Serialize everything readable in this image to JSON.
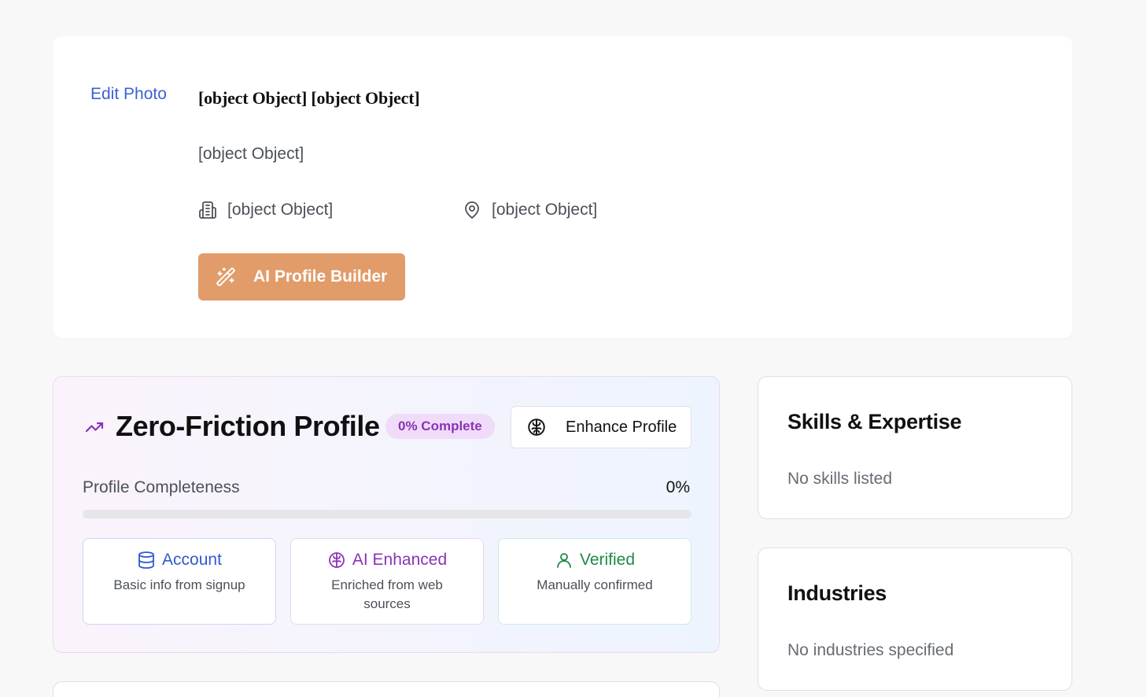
{
  "profile": {
    "edit_photo": "Edit Photo",
    "name": "[object Object] [object Object]",
    "headline": "[object Object]",
    "company": "[object Object]",
    "location": "[object Object]",
    "ai_builder_label": "AI Profile Builder",
    "icons": {
      "company": "building-icon",
      "location": "map-pin-icon",
      "builder": "magic-wand-icon"
    }
  },
  "zero_friction": {
    "title": "Zero-Friction Profile",
    "badge": "0% Complete",
    "enhance_label": "Enhance Profile",
    "completeness_label": "Profile Completeness",
    "completeness_value": "0%",
    "completeness_fraction": 0,
    "sources": [
      {
        "title": "Account",
        "description": "Basic info from signup",
        "icon": "database-icon",
        "color": "#2f5bd0"
      },
      {
        "title": "AI Enhanced",
        "description": "Enriched from web sources",
        "icon": "brain-icon",
        "color": "#8a33b8"
      },
      {
        "title": "Verified",
        "description": "Manually confirmed",
        "icon": "user-icon",
        "color": "#1d8a45"
      }
    ],
    "accent_color": "#8a33b8"
  },
  "skills": {
    "title": "Skills & Expertise",
    "empty_text": "No skills listed"
  },
  "industries": {
    "title": "Industries",
    "empty_text": "No industries specified"
  },
  "colors": {
    "builder_button": "#e19c69",
    "link": "#3b63d1",
    "page_bg": "#f8f8f8"
  }
}
